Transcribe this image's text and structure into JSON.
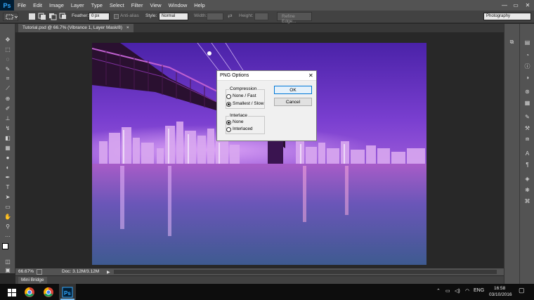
{
  "app": {
    "logo": "Ps"
  },
  "menu": [
    "File",
    "Edit",
    "Image",
    "Layer",
    "Type",
    "Select",
    "Filter",
    "View",
    "Window",
    "Help"
  ],
  "window_controls": {
    "minimize": "—",
    "maximize": "▭",
    "close": "✕"
  },
  "options_bar": {
    "feather_label": "Feather:",
    "feather_value": "0 px",
    "anti_alias_label": "Anti-alias",
    "style_label": "Style:",
    "style_value": "Normal",
    "width_label": "Width:",
    "height_label": "Height:",
    "refine_edge_label": "Refine Edge...",
    "workspace_value": "Photography"
  },
  "document_tab": {
    "label": "Tutorial.psd @ 66.7% (Vibrance 1, Layer Mask/8)",
    "close": "×"
  },
  "status_bar": {
    "zoom": "66.67%",
    "doc_size": "Doc: 3.12M/3.12M"
  },
  "mini_bridge": {
    "label": "Mini Bridge"
  },
  "dialog": {
    "title": "PNG Options",
    "close": "✕",
    "compression_label": "Compression",
    "compression_options": [
      "None / Fast",
      "Smallest / Slow"
    ],
    "compression_selected": 1,
    "interlace_label": "Interlace",
    "interlace_options": [
      "None",
      "Interlaced"
    ],
    "interlace_selected": 0,
    "ok_label": "OK",
    "cancel_label": "Cancel"
  },
  "taskbar": {
    "language": "ENG",
    "time": "16:58",
    "date": "03/10/2016"
  },
  "colors": {
    "ps_bg": "#535353",
    "canvas_bg": "#282828",
    "photo_sky_top": "#6a2fc4",
    "photo_water": "#7a4ab0",
    "accent_blue": "#0078d7"
  }
}
